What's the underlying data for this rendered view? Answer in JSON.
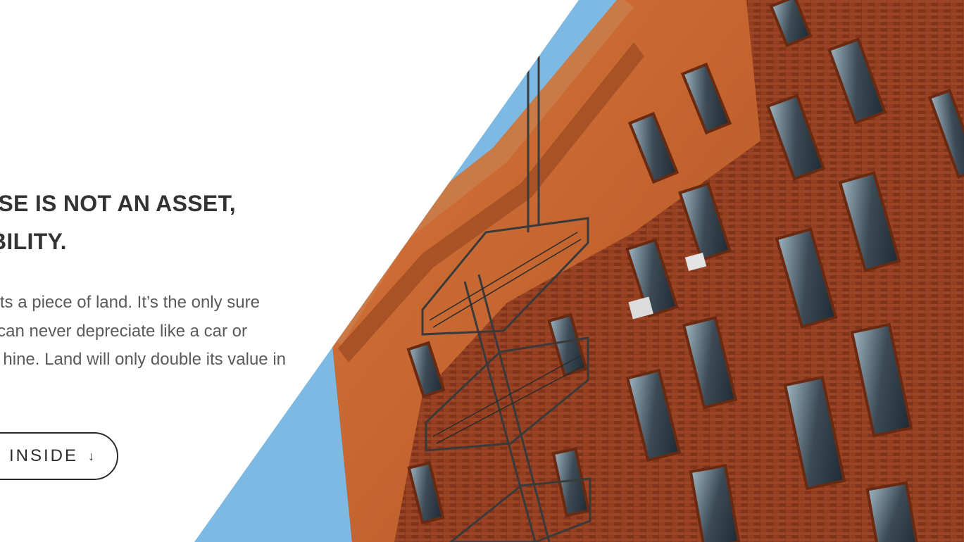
{
  "hero": {
    "headline_line1": "USE IS NOT AN ASSET,",
    "headline_line2": "BILITY.",
    "body_line1": "ts a piece of land. It’s the only sure",
    "body_line2": "can never depreciate like a car or",
    "body_line3": "hine. Land will only double its value in",
    "cta_label": "INSIDE",
    "cta_icon": "arrow-down-icon",
    "cta_icon_glyph": "↓"
  },
  "colors": {
    "sky": "#7db9e2",
    "brick": "#8a3a1e",
    "terracotta": "#c8642e",
    "text_heading": "#333333",
    "text_body": "#5a5a5a",
    "button_border": "#2c2c2c"
  }
}
